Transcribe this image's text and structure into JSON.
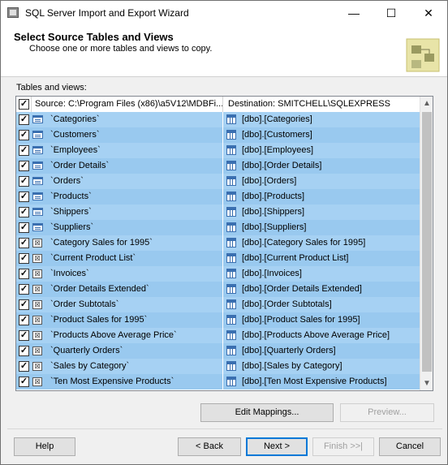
{
  "window": {
    "title": "SQL Server Import and Export Wizard",
    "minimize": "—",
    "maximize": "☐",
    "close": "✕"
  },
  "header": {
    "title": "Select Source Tables and Views",
    "subtitle": "Choose one or more tables and views to copy."
  },
  "list": {
    "label": "Tables and views:",
    "columns": {
      "source": "Source: C:\\Program Files (x86)\\a5V12\\MDBFi...",
      "destination": "Destination: SMITCHELL\\SQLEXPRESS"
    },
    "rows": [
      {
        "checked": true,
        "kind": "table",
        "source": "`Categories`",
        "destination": "[dbo].[Categories]"
      },
      {
        "checked": true,
        "kind": "table",
        "source": "`Customers`",
        "destination": "[dbo].[Customers]"
      },
      {
        "checked": true,
        "kind": "table",
        "source": "`Employees`",
        "destination": "[dbo].[Employees]"
      },
      {
        "checked": true,
        "kind": "table",
        "source": "`Order Details`",
        "destination": "[dbo].[Order Details]"
      },
      {
        "checked": true,
        "kind": "table",
        "source": "`Orders`",
        "destination": "[dbo].[Orders]"
      },
      {
        "checked": true,
        "kind": "table",
        "source": "`Products`",
        "destination": "[dbo].[Products]"
      },
      {
        "checked": true,
        "kind": "table",
        "source": "`Shippers`",
        "destination": "[dbo].[Shippers]"
      },
      {
        "checked": true,
        "kind": "table",
        "source": "`Suppliers`",
        "destination": "[dbo].[Suppliers]"
      },
      {
        "checked": true,
        "kind": "view",
        "source": "`Category Sales for 1995`",
        "destination": "[dbo].[Category Sales for 1995]"
      },
      {
        "checked": true,
        "kind": "view",
        "source": "`Current Product List`",
        "destination": "[dbo].[Current Product List]"
      },
      {
        "checked": true,
        "kind": "view",
        "source": "`Invoices`",
        "destination": "[dbo].[Invoices]"
      },
      {
        "checked": true,
        "kind": "view",
        "source": "`Order Details Extended`",
        "destination": "[dbo].[Order Details Extended]"
      },
      {
        "checked": true,
        "kind": "view",
        "source": "`Order Subtotals`",
        "destination": "[dbo].[Order Subtotals]"
      },
      {
        "checked": true,
        "kind": "view",
        "source": "`Product Sales for 1995`",
        "destination": "[dbo].[Product Sales for 1995]"
      },
      {
        "checked": true,
        "kind": "view",
        "source": "`Products Above Average Price`",
        "destination": "[dbo].[Products Above Average Price]"
      },
      {
        "checked": true,
        "kind": "view",
        "source": "`Quarterly Orders`",
        "destination": "[dbo].[Quarterly Orders]"
      },
      {
        "checked": true,
        "kind": "view",
        "source": "`Sales by Category`",
        "destination": "[dbo].[Sales by Category]"
      },
      {
        "checked": true,
        "kind": "view",
        "source": "`Ten Most Expensive Products`",
        "destination": "[dbo].[Ten Most Expensive Products]"
      }
    ]
  },
  "buttons": {
    "edit_mappings": "Edit Mappings...",
    "preview": "Preview...",
    "help": "Help",
    "back": "< Back",
    "next": "Next >",
    "finish": "Finish >>|",
    "cancel": "Cancel"
  },
  "colors": {
    "row_selected": "#99c9ef",
    "accent": "#0078d7"
  }
}
